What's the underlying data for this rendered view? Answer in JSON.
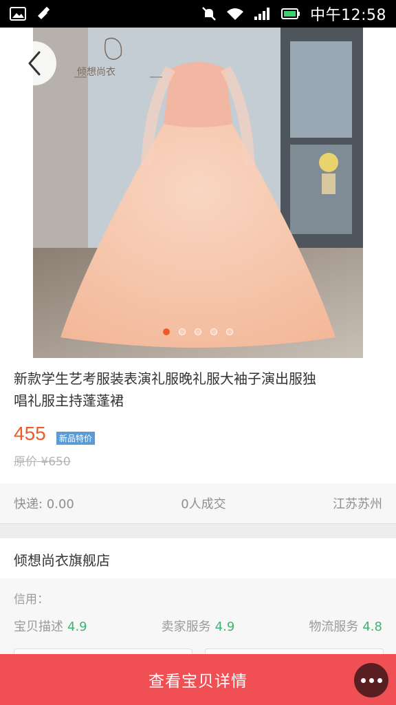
{
  "status_bar": {
    "time": "中午12:58",
    "icons": [
      "gallery-icon",
      "usb-icon",
      "mute-icon",
      "wifi-icon",
      "signal-icon",
      "battery-icon"
    ]
  },
  "hero": {
    "brand_logo_text": "倾想尚衣",
    "carousel_count": 5,
    "carousel_active_index": 0,
    "accent": "#f05a28"
  },
  "product": {
    "title": "新款学生艺考服装表演礼服晚礼服大袖子演出服独唱礼服主持蓬蓬裙",
    "price": "455",
    "badge": "新品特价",
    "original_price": "原价 ¥650"
  },
  "shipping": {
    "fee": "快递: 0.00",
    "sold": "0人成交",
    "location": "江苏苏州"
  },
  "shop": {
    "name": "倾想尚衣旗舰店",
    "credit_label": "信用：",
    "ratings": [
      {
        "label": "宝贝描述",
        "score": "4.9"
      },
      {
        "label": "卖家服务",
        "score": "4.9"
      },
      {
        "label": "物流服务",
        "score": "4.8"
      }
    ]
  },
  "bottom": {
    "cta_label": "查看宝贝详情",
    "more_icon": "more-icon"
  }
}
